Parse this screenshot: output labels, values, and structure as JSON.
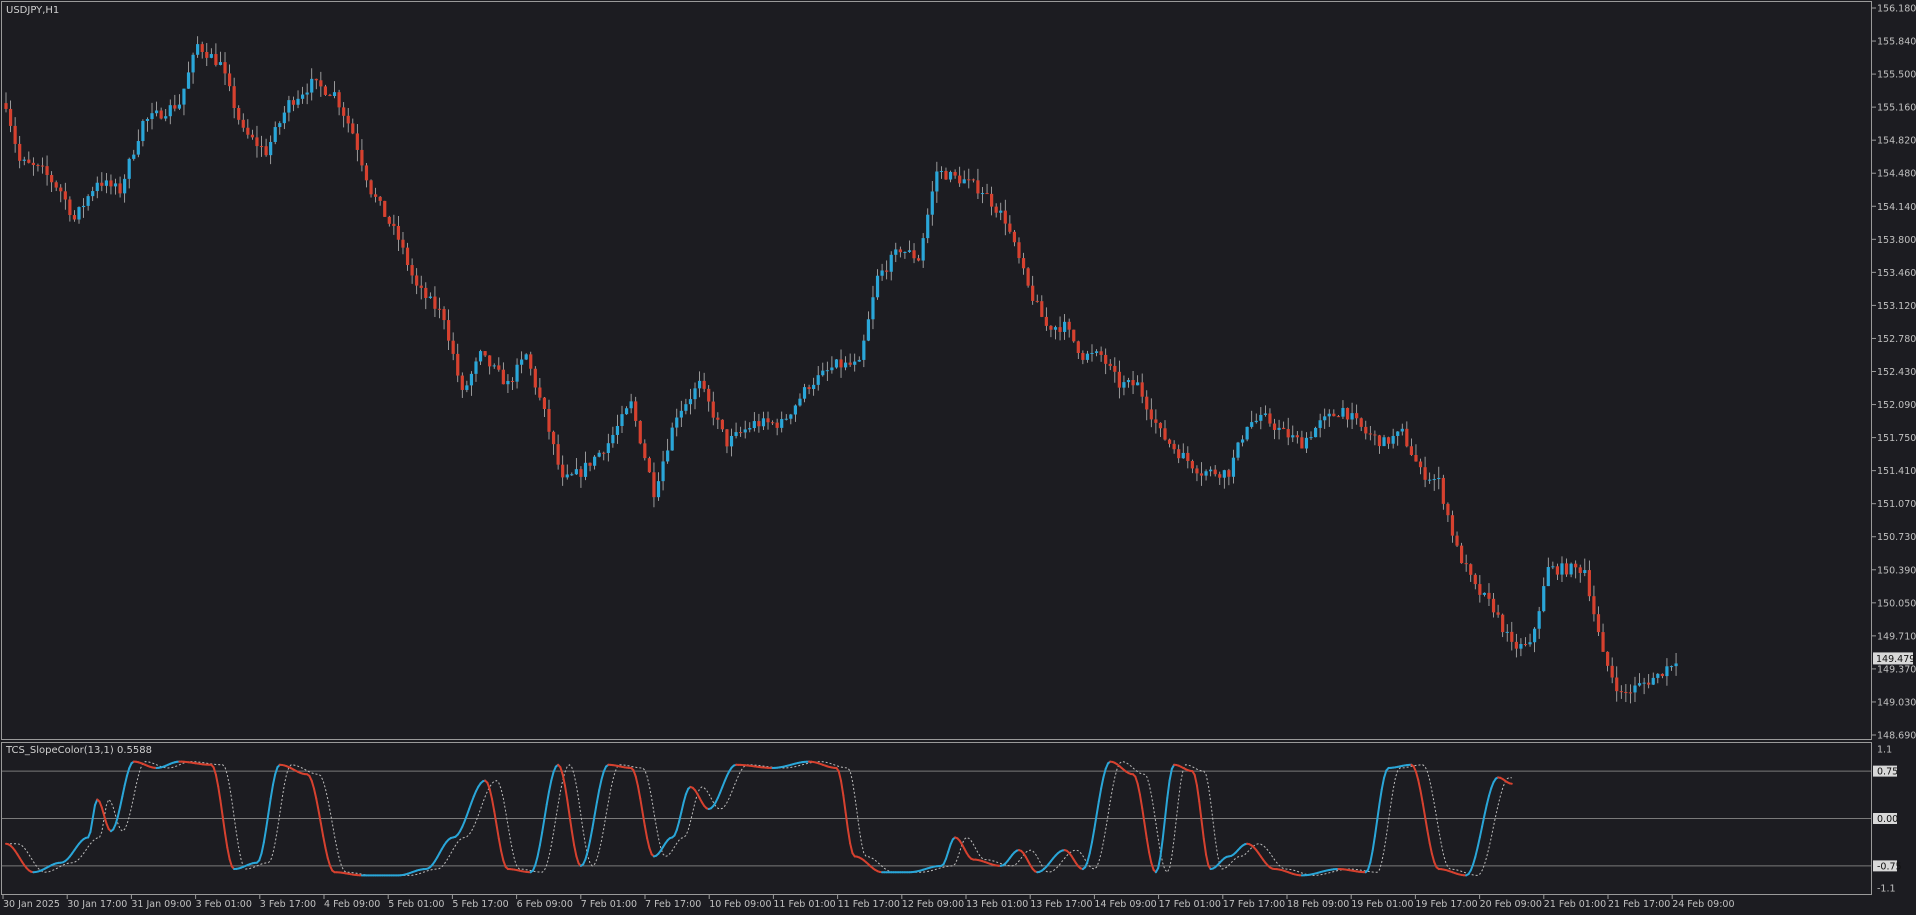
{
  "main_title": "USDJPY,H1",
  "indicator_title": "TCS_SlopeColor(13,1) 0.5588",
  "current_price_label": "149.479",
  "colors": {
    "background": "#1c1c21",
    "bull": "#2aa6d8",
    "bear": "#d6412f",
    "grid": "#808080",
    "text": "#c0c0c0"
  },
  "price_axis": {
    "labels": [
      "156.180",
      "155.840",
      "155.500",
      "155.160",
      "154.820",
      "154.480",
      "154.140",
      "153.800",
      "153.460",
      "153.120",
      "152.780",
      "152.430",
      "152.090",
      "151.750",
      "151.410",
      "151.070",
      "150.730",
      "150.390",
      "150.050",
      "149.710",
      "149.370",
      "149.030",
      "148.690"
    ]
  },
  "indicator_axis": {
    "labels": [
      "1.1",
      "0.75",
      "0.00",
      "-0.75",
      "-1.1"
    ],
    "levels": [
      0.75,
      0.0,
      -0.75
    ]
  },
  "time_axis": {
    "labels": [
      "30 Jan 2025",
      "30 Jan 17:00",
      "31 Jan 09:00",
      "3 Feb 01:00",
      "3 Feb 17:00",
      "4 Feb 09:00",
      "5 Feb 01:00",
      "5 Feb 17:00",
      "6 Feb 09:00",
      "7 Feb 01:00",
      "7 Feb 17:00",
      "10 Feb 09:00",
      "11 Feb 01:00",
      "11 Feb 17:00",
      "12 Feb 09:00",
      "13 Feb 01:00",
      "13 Feb 17:00",
      "14 Feb 09:00",
      "17 Feb 01:00",
      "17 Feb 17:00",
      "18 Feb 09:00",
      "19 Feb 01:00",
      "19 Feb 17:00",
      "20 Feb 09:00",
      "21 Feb 01:00",
      "21 Feb 17:00",
      "24 Feb 09:00"
    ]
  },
  "chart_data": [
    {
      "type": "candlestick",
      "symbol": "USDJPY",
      "timeframe": "H1",
      "ylim": [
        148.69,
        156.18
      ],
      "last_price": 149.479,
      "path": [
        {
          "i": 0,
          "p": 155.2
        },
        {
          "i": 3,
          "p": 154.6
        },
        {
          "i": 8,
          "p": 154.5
        },
        {
          "i": 12,
          "p": 154.3
        },
        {
          "i": 15,
          "p": 154.0
        },
        {
          "i": 20,
          "p": 154.4
        },
        {
          "i": 25,
          "p": 154.3
        },
        {
          "i": 30,
          "p": 155.0
        },
        {
          "i": 38,
          "p": 155.2
        },
        {
          "i": 42,
          "p": 155.8
        },
        {
          "i": 47,
          "p": 155.6
        },
        {
          "i": 52,
          "p": 154.9
        },
        {
          "i": 57,
          "p": 154.7
        },
        {
          "i": 62,
          "p": 155.2
        },
        {
          "i": 67,
          "p": 155.4
        },
        {
          "i": 72,
          "p": 155.3
        },
        {
          "i": 76,
          "p": 154.9
        },
        {
          "i": 80,
          "p": 154.3
        },
        {
          "i": 86,
          "p": 153.8
        },
        {
          "i": 90,
          "p": 153.3
        },
        {
          "i": 96,
          "p": 153.0
        },
        {
          "i": 100,
          "p": 152.2
        },
        {
          "i": 104,
          "p": 152.6
        },
        {
          "i": 110,
          "p": 152.3
        },
        {
          "i": 114,
          "p": 152.6
        },
        {
          "i": 118,
          "p": 152.0
        },
        {
          "i": 122,
          "p": 151.3
        },
        {
          "i": 126,
          "p": 151.4
        },
        {
          "i": 132,
          "p": 151.7
        },
        {
          "i": 137,
          "p": 152.1
        },
        {
          "i": 142,
          "p": 151.2
        },
        {
          "i": 147,
          "p": 152.0
        },
        {
          "i": 152,
          "p": 152.3
        },
        {
          "i": 158,
          "p": 151.7
        },
        {
          "i": 164,
          "p": 151.9
        },
        {
          "i": 170,
          "p": 151.9
        },
        {
          "i": 176,
          "p": 152.3
        },
        {
          "i": 182,
          "p": 152.5
        },
        {
          "i": 187,
          "p": 152.5
        },
        {
          "i": 191,
          "p": 153.4
        },
        {
          "i": 196,
          "p": 153.7
        },
        {
          "i": 200,
          "p": 153.6
        },
        {
          "i": 204,
          "p": 154.5
        },
        {
          "i": 210,
          "p": 154.4
        },
        {
          "i": 214,
          "p": 154.3
        },
        {
          "i": 219,
          "p": 154.0
        },
        {
          "i": 224,
          "p": 153.3
        },
        {
          "i": 228,
          "p": 152.9
        },
        {
          "i": 232,
          "p": 152.9
        },
        {
          "i": 236,
          "p": 152.6
        },
        {
          "i": 240,
          "p": 152.6
        },
        {
          "i": 244,
          "p": 152.3
        },
        {
          "i": 248,
          "p": 152.3
        },
        {
          "i": 253,
          "p": 151.8
        },
        {
          "i": 257,
          "p": 151.6
        },
        {
          "i": 262,
          "p": 151.4
        },
        {
          "i": 268,
          "p": 151.4
        },
        {
          "i": 272,
          "p": 151.9
        },
        {
          "i": 276,
          "p": 151.95
        },
        {
          "i": 280,
          "p": 151.8
        },
        {
          "i": 284,
          "p": 151.7
        },
        {
          "i": 288,
          "p": 151.9
        },
        {
          "i": 293,
          "p": 152.05
        },
        {
          "i": 298,
          "p": 151.8
        },
        {
          "i": 302,
          "p": 151.7
        },
        {
          "i": 306,
          "p": 151.8
        },
        {
          "i": 310,
          "p": 151.4
        },
        {
          "i": 314,
          "p": 151.3
        },
        {
          "i": 318,
          "p": 150.6
        },
        {
          "i": 322,
          "p": 150.2
        },
        {
          "i": 326,
          "p": 150.0
        },
        {
          "i": 330,
          "p": 149.6
        },
        {
          "i": 334,
          "p": 149.6
        },
        {
          "i": 338,
          "p": 150.4
        },
        {
          "i": 342,
          "p": 150.4
        },
        {
          "i": 346,
          "p": 150.4
        },
        {
          "i": 350,
          "p": 149.5
        },
        {
          "i": 354,
          "p": 149.1
        },
        {
          "i": 358,
          "p": 149.2
        },
        {
          "i": 362,
          "p": 149.3
        },
        {
          "i": 366,
          "p": 149.48
        }
      ]
    },
    {
      "type": "line",
      "name": "TCS_SlopeColor(13,1)",
      "ylim": [
        -1.1,
        1.1
      ],
      "path": [
        {
          "i": 0,
          "v": -0.4
        },
        {
          "i": 6,
          "v": -0.85
        },
        {
          "i": 12,
          "v": -0.7
        },
        {
          "i": 18,
          "v": -0.3
        },
        {
          "i": 20,
          "v": 0.3
        },
        {
          "i": 23,
          "v": -0.2
        },
        {
          "i": 28,
          "v": 0.9
        },
        {
          "i": 33,
          "v": 0.8
        },
        {
          "i": 38,
          "v": 0.9
        },
        {
          "i": 45,
          "v": 0.85
        },
        {
          "i": 50,
          "v": -0.8
        },
        {
          "i": 55,
          "v": -0.7
        },
        {
          "i": 60,
          "v": 0.85
        },
        {
          "i": 66,
          "v": 0.7
        },
        {
          "i": 72,
          "v": -0.85
        },
        {
          "i": 78,
          "v": -0.9
        },
        {
          "i": 86,
          "v": -0.9
        },
        {
          "i": 92,
          "v": -0.8
        },
        {
          "i": 98,
          "v": -0.3
        },
        {
          "i": 105,
          "v": 0.6
        },
        {
          "i": 110,
          "v": -0.8
        },
        {
          "i": 115,
          "v": -0.85
        },
        {
          "i": 121,
          "v": 0.85
        },
        {
          "i": 126,
          "v": -0.75
        },
        {
          "i": 132,
          "v": 0.85
        },
        {
          "i": 137,
          "v": 0.8
        },
        {
          "i": 142,
          "v": -0.6
        },
        {
          "i": 146,
          "v": -0.3
        },
        {
          "i": 150,
          "v": 0.5
        },
        {
          "i": 154,
          "v": 0.15
        },
        {
          "i": 160,
          "v": 0.85
        },
        {
          "i": 168,
          "v": 0.8
        },
        {
          "i": 176,
          "v": 0.9
        },
        {
          "i": 182,
          "v": 0.8
        },
        {
          "i": 186,
          "v": -0.6
        },
        {
          "i": 192,
          "v": -0.85
        },
        {
          "i": 198,
          "v": -0.85
        },
        {
          "i": 205,
          "v": -0.75
        },
        {
          "i": 208,
          "v": -0.3
        },
        {
          "i": 212,
          "v": -0.65
        },
        {
          "i": 218,
          "v": -0.75
        },
        {
          "i": 222,
          "v": -0.5
        },
        {
          "i": 226,
          "v": -0.85
        },
        {
          "i": 232,
          "v": -0.5
        },
        {
          "i": 236,
          "v": -0.8
        },
        {
          "i": 242,
          "v": 0.9
        },
        {
          "i": 247,
          "v": 0.7
        },
        {
          "i": 252,
          "v": -0.85
        },
        {
          "i": 256,
          "v": 0.85
        },
        {
          "i": 260,
          "v": 0.75
        },
        {
          "i": 264,
          "v": -0.8
        },
        {
          "i": 268,
          "v": -0.6
        },
        {
          "i": 272,
          "v": -0.4
        },
        {
          "i": 278,
          "v": -0.8
        },
        {
          "i": 284,
          "v": -0.9
        },
        {
          "i": 292,
          "v": -0.8
        },
        {
          "i": 298,
          "v": -0.85
        },
        {
          "i": 303,
          "v": 0.8
        },
        {
          "i": 308,
          "v": 0.85
        },
        {
          "i": 314,
          "v": -0.8
        },
        {
          "i": 320,
          "v": -0.9
        },
        {
          "i": 327,
          "v": 0.65
        },
        {
          "i": 330,
          "v": 0.55
        }
      ]
    }
  ]
}
